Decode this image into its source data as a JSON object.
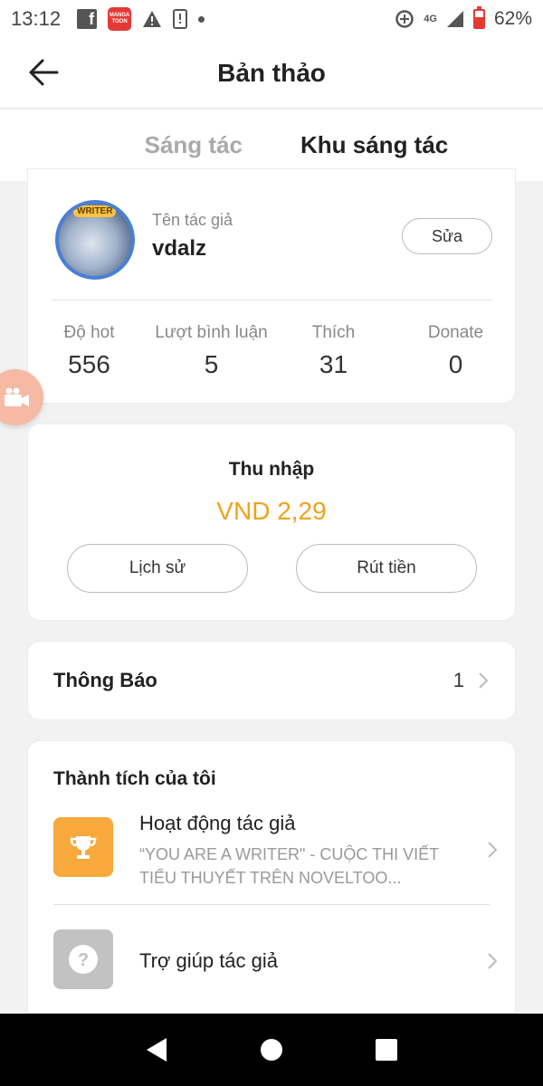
{
  "status_bar": {
    "time": "13:12",
    "network": "4G",
    "battery": "62%",
    "battery_level": 0.62
  },
  "header": {
    "title": "Bản thảo",
    "back_icon": "arrow-left-icon"
  },
  "tabs": [
    {
      "label": "Sáng tác",
      "active": false
    },
    {
      "label": "Khu sáng tác",
      "active": true
    }
  ],
  "author": {
    "label": "Tên tác giả",
    "name": "vdalz",
    "edit_label": "Sửa",
    "avatar_badge": "WRITER",
    "stats": [
      {
        "label": "Độ hot",
        "value": "556"
      },
      {
        "label": "Lượt bình luận",
        "value": "5"
      },
      {
        "label": "Thích",
        "value": "31"
      },
      {
        "label": "Donate",
        "value": "0"
      }
    ]
  },
  "income": {
    "title": "Thu nhập",
    "amount": "VND 2,29",
    "history_label": "Lịch sử",
    "withdraw_label": "Rút tiền"
  },
  "notice": {
    "title": "Thông Báo",
    "count": "1"
  },
  "achievements": {
    "title": "Thành tích của tôi",
    "items": [
      {
        "icon": "trophy-icon",
        "title": "Hoạt động tác giả",
        "subtitle": "“YOU ARE A WRITER\" - CUỘC THI VIẾT TIỂU THUYẾT TRÊN NOVELTOO..."
      },
      {
        "icon": "help-icon",
        "title": "Trợ giúp tác giả"
      }
    ]
  },
  "colors": {
    "accent": "#e53935",
    "income": "#f0a21a",
    "trophy_bg": "#f7a93b"
  }
}
